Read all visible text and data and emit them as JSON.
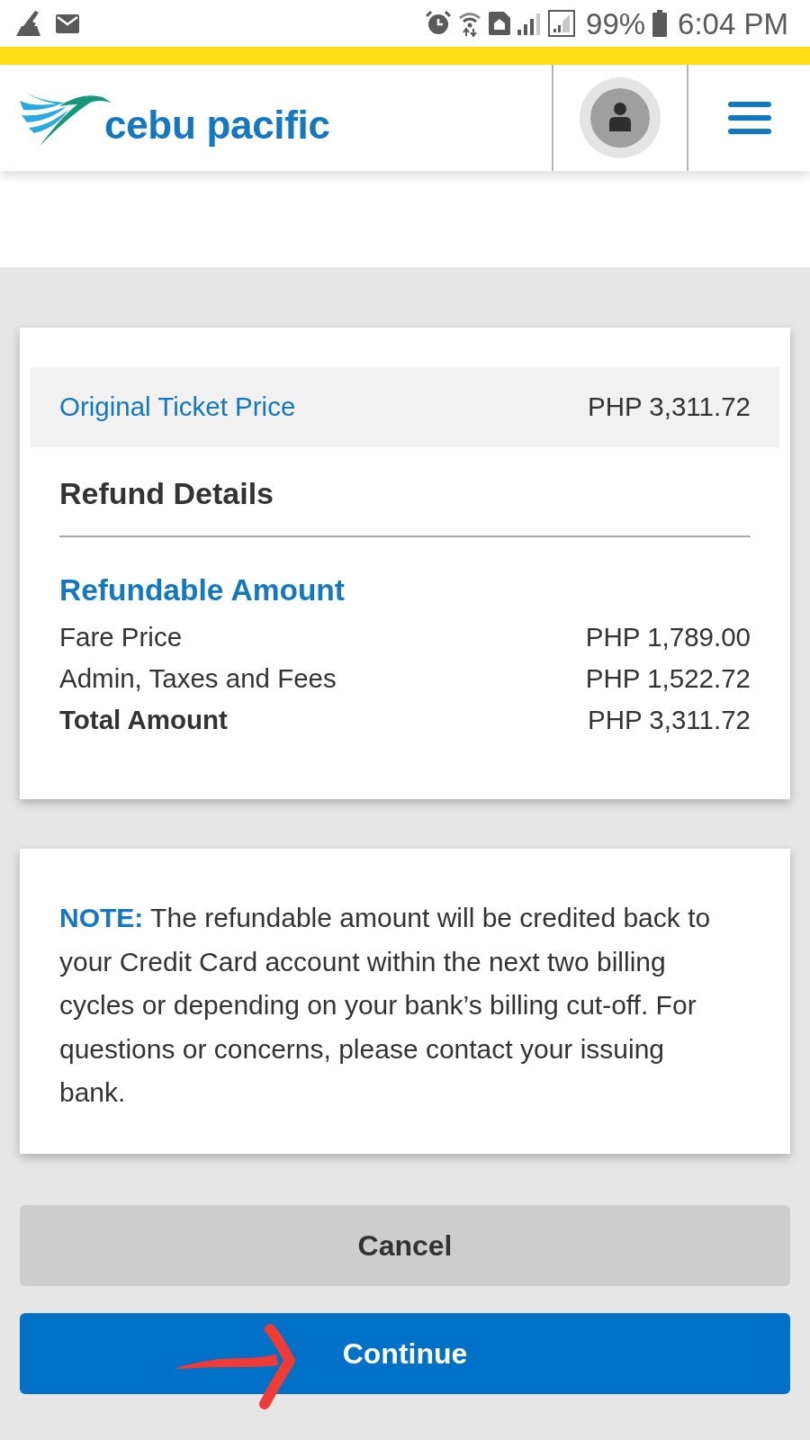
{
  "status_bar": {
    "battery": "99%",
    "time": "6:04 PM"
  },
  "header": {
    "logo_text": "cebu pacific"
  },
  "original_price": {
    "label": "Original Ticket Price",
    "value": "PHP 3,311.72"
  },
  "refund_details": {
    "title": "Refund Details",
    "section_title": "Refundable Amount",
    "rows": [
      {
        "label": "Fare Price",
        "value": "PHP 1,789.00",
        "emphasized": false
      },
      {
        "label": "Admin, Taxes and Fees",
        "value": "PHP 1,522.72",
        "emphasized": false
      },
      {
        "label": "Total Amount",
        "value": "PHP 3,311.72",
        "emphasized": true
      }
    ]
  },
  "note": {
    "text": "**NOTE:** The refundable amount will be credited back to your Credit Card account within the next two billing cycles or depending on your bank’s billing cut-off. For questions or concerns, please contact your issuing bank."
  },
  "buttons": [
    {
      "label": "Cancel",
      "kind": "secondary"
    },
    {
      "label": "Continue",
      "kind": "primary"
    }
  ]
}
